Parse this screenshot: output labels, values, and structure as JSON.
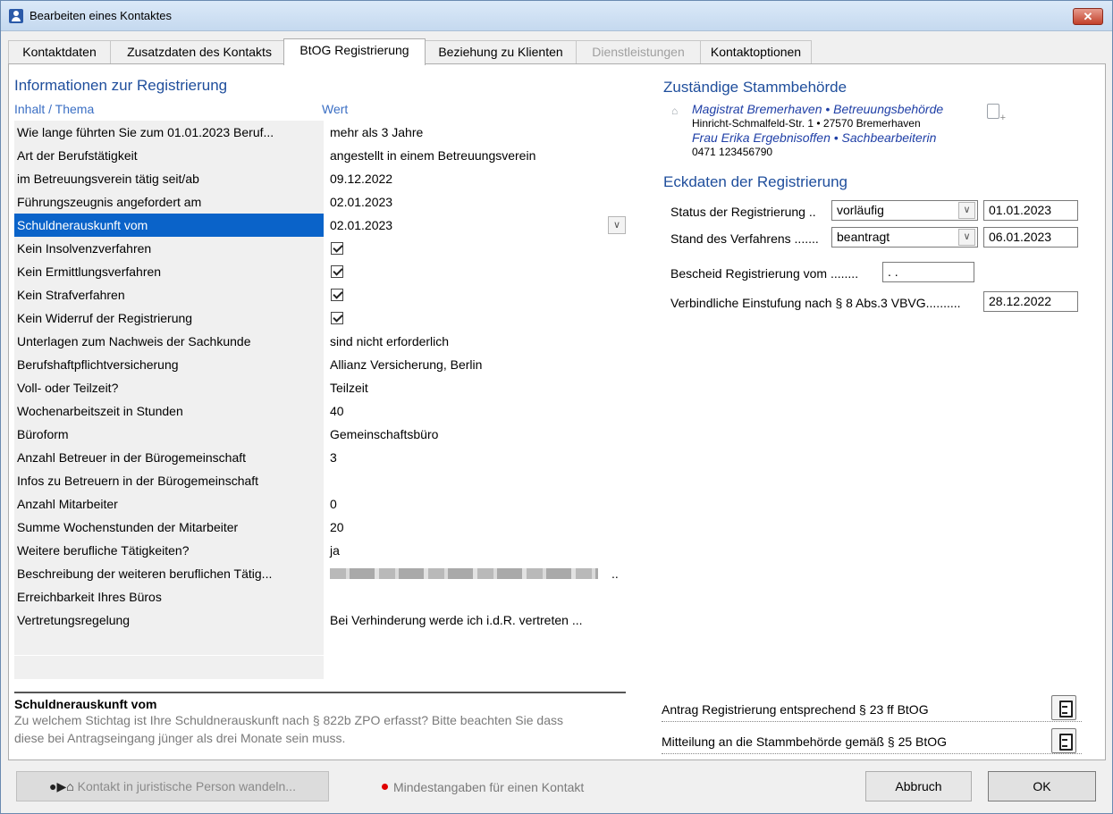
{
  "window": {
    "title": "Bearbeiten eines Kontaktes",
    "close_label": "✕"
  },
  "tabs": [
    {
      "label": "Kontaktdaten"
    },
    {
      "label": "Zusatzdaten des Kontakts"
    },
    {
      "label": "BtOG Registrierung"
    },
    {
      "label": "Beziehung zu Klienten"
    },
    {
      "label": "Dienstleistungen"
    },
    {
      "label": "Kontaktoptionen"
    }
  ],
  "left": {
    "title": "Informationen zur Registrierung",
    "col_topic": "Inhalt / Thema",
    "col_value": "Wert",
    "rows": [
      {
        "k": "Wie lange führten Sie zum 01.01.2023 Beruf...",
        "v": "mehr als 3 Jahre"
      },
      {
        "k": "Art der Berufstätigkeit",
        "v": "angestellt in einem Betreuungsverein"
      },
      {
        "k": "im Betreuungsverein tätig seit/ab",
        "v": "09.12.2022"
      },
      {
        "k": "Führungszeugnis angefordert am",
        "v": "02.01.2023"
      },
      {
        "k": "Schuldnerauskunft vom",
        "v": "02.01.2023"
      },
      {
        "k": "Kein Insolvenzverfahren",
        "v": ""
      },
      {
        "k": "Kein Ermittlungsverfahren",
        "v": ""
      },
      {
        "k": "Kein Strafverfahren",
        "v": ""
      },
      {
        "k": "Kein Widerruf der Registrierung",
        "v": ""
      },
      {
        "k": "Unterlagen zum Nachweis der Sachkunde",
        "v": "sind nicht erforderlich"
      },
      {
        "k": "Berufshaftpflichtversicherung",
        "v": "Allianz Versicherung, Berlin"
      },
      {
        "k": "Voll- oder Teilzeit?",
        "v": "Teilzeit"
      },
      {
        "k": "Wochenarbeitszeit in Stunden",
        "v": "40"
      },
      {
        "k": "Büroform",
        "v": "Gemeinschaftsbüro"
      },
      {
        "k": "Anzahl Betreuer in der Bürogemeinschaft",
        "v": "3"
      },
      {
        "k": "Infos zu Betreuern in der Bürogemeinschaft",
        "v": ""
      },
      {
        "k": "Anzahl Mitarbeiter",
        "v": "0"
      },
      {
        "k": "Summe Wochenstunden der Mitarbeiter",
        "v": "20"
      },
      {
        "k": "Weitere berufliche Tätigkeiten?",
        "v": "ja"
      },
      {
        "k": "Beschreibung der weiteren beruflichen Tätig...",
        "v": ".."
      },
      {
        "k": "Erreichbarkeit Ihres Büros",
        "v": ""
      },
      {
        "k": "Vertretungsregelung",
        "v": "Bei Verhinderung werde ich i.d.R. vertreten ..."
      }
    ],
    "help_title": "Schuldnerauskunft vom",
    "help_text_1": "Zu welchem Stichtag ist Ihre Schuldnerauskunft nach § 822b ZPO erfasst? Bitte beachten Sie dass",
    "help_text_2": "diese bei Antragseingang jünger als drei Monate sein muss."
  },
  "right": {
    "authority_title": "Zuständige Stammbehörde",
    "authority_name": "Magistrat Bremerhaven • Betreuungsbehörde",
    "authority_address": "Hinricht-Schmalfeld-Str. 1 • 27570 Bremerhaven",
    "authority_contact": "Frau Erika Ergebnisoffen • Sachbearbeiterin",
    "authority_phone": "0471 123456790",
    "eck_title": "Eckdaten der Registrierung",
    "status_label": "Status der Registrierung ..",
    "status_value": "vorläufig",
    "status_date": "01.01.2023",
    "stand_label": "Stand des Verfahrens .......",
    "stand_value": "beantragt",
    "stand_date": "06.01.2023",
    "bescheid_label": "Bescheid Registrierung vom ........",
    "bescheid_value": " .  .",
    "einstufung_label": "Verbindliche Einstufung nach § 8 Abs.3 VBVG..........",
    "einstufung_value": "28.12.2022",
    "doc1_label": "Antrag Registrierung entsprechend § 23 ff BtOG",
    "doc2_label": "Mitteilung an die Stammbehörde gemäß § 25 BtOG"
  },
  "footer": {
    "convert_label": "Kontakt in juristische Person wandeln...",
    "required_label": "Mindestangaben für einen Kontakt",
    "cancel_label": "Abbruch",
    "ok_label": "OK"
  }
}
